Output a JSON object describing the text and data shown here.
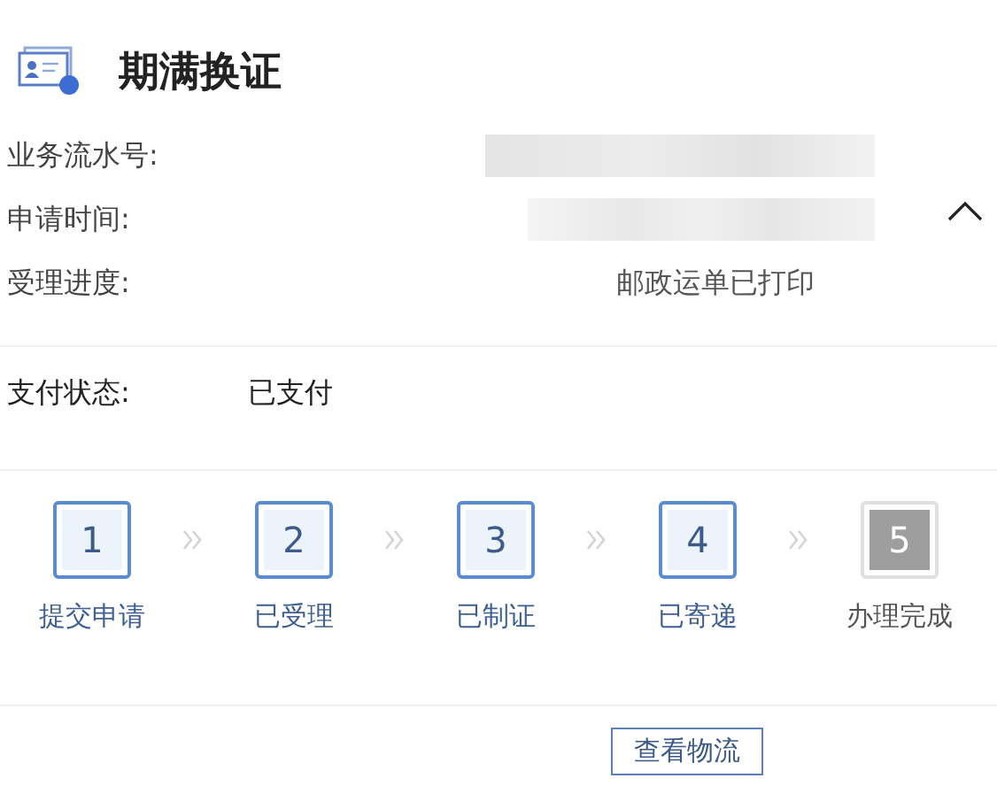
{
  "title": "期满换证",
  "details": {
    "expanded": true,
    "rows": [
      {
        "label": "业务流水号:",
        "kind": "redacted"
      },
      {
        "label": "申请时间:",
        "kind": "redacted"
      },
      {
        "label": "受理进度:",
        "kind": "text",
        "value": "邮政运单已打印"
      }
    ]
  },
  "payment": {
    "label": "支付状态:",
    "value": "已支付"
  },
  "steps": [
    {
      "number": "1",
      "label": "提交申请",
      "done": true
    },
    {
      "number": "2",
      "label": "已受理",
      "done": true
    },
    {
      "number": "3",
      "label": "已制证",
      "done": true
    },
    {
      "number": "4",
      "label": "已寄递",
      "done": true
    },
    {
      "number": "5",
      "label": "办理完成",
      "done": false
    }
  ],
  "logistics_button": "查看物流"
}
